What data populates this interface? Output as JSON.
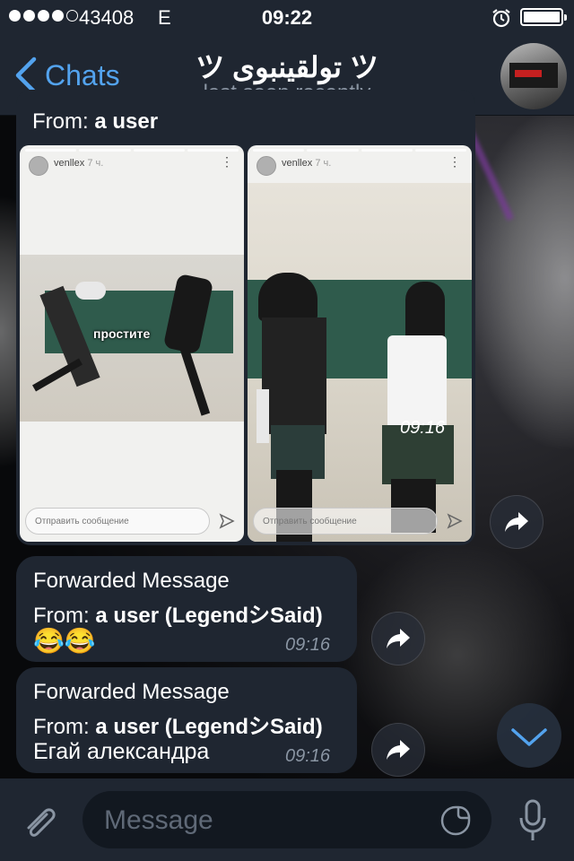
{
  "status": {
    "carrier": "43408",
    "network": "E",
    "time": "09:22",
    "battery_level": 1.0
  },
  "header": {
    "back_label": "Chats",
    "title": "ツ تولقينبوی ツ",
    "subtitle": "last seen recently"
  },
  "messages": [
    {
      "type": "media",
      "from_prefix": "From: ",
      "from_user": "a user",
      "stories": [
        {
          "username": "venllex",
          "age": "7 ч.",
          "caption": "простите",
          "reply_placeholder": "Отправить сообщение"
        },
        {
          "username": "venllex",
          "age": "7 ч.",
          "reply_placeholder": "Отправить сообщение"
        }
      ],
      "time": "09:16"
    },
    {
      "type": "text",
      "label": "Forwarded Message",
      "from_prefix": "From: ",
      "from_user": "a user (LegendシSaid)",
      "text": "😂😂",
      "time": "09:16"
    },
    {
      "type": "text",
      "label": "Forwarded Message",
      "from_prefix": "From: ",
      "from_user": "a user (LegendシSaid)",
      "text": "Егай александра",
      "time": "09:16"
    }
  ],
  "input": {
    "placeholder": "Message"
  },
  "icons": [
    "chevron-left-icon",
    "alarm-icon",
    "battery-icon",
    "share-icon",
    "paperclip-icon",
    "sticker-icon",
    "microphone-icon",
    "chevron-down-icon",
    "send-icon"
  ],
  "colors": {
    "accent": "#53a3ee",
    "bubble": "#1f2631",
    "bar": "#1f2631"
  }
}
